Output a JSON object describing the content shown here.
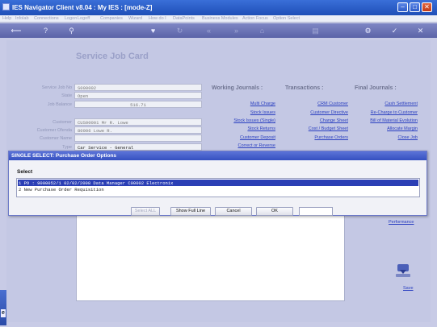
{
  "window": {
    "title": "IES Navigator Client v8.04 : My IES :      [mode-Z]"
  },
  "menu": [
    {
      "label": "Help",
      "active": true
    },
    {
      "label": "Infolab",
      "active": true
    },
    {
      "label": "Connections",
      "active": false
    },
    {
      "label": "Logon",
      "active": false
    },
    {
      "label": "Logoff",
      "active": true
    },
    {
      "label": "Companies",
      "active": false
    },
    {
      "label": "Wizard",
      "active": false
    },
    {
      "label": "How do I",
      "active": false
    },
    {
      "label": "DataPoints",
      "active": false
    },
    {
      "label": "Business Modules",
      "active": false
    },
    {
      "label": "Action Focus",
      "active": false
    },
    {
      "label": "Option Select",
      "active": false
    }
  ],
  "page": {
    "heading": "Service Job Card"
  },
  "form": {
    "service_job_label": "Service Job No",
    "service_job_value": "S000002",
    "state_label": "State",
    "state_value": "Open",
    "job_balance_label": "Job Balance",
    "job_balance_value": "516.71",
    "customer_label": "Customer",
    "customer_value": "CUS00001 Mr R. Lowe",
    "customer_ofenda_label": "Customer Ofenda",
    "customer_ofenda_value": "80006 Lowe R.",
    "customer_name_label": "Customer Name",
    "type_label": "Type",
    "type_value": "Car Service - General"
  },
  "working_journals": {
    "heading": "Working Journals :",
    "links": [
      "Multi Charge",
      "Stock Issues",
      "Stock Issues (Single)",
      "Stock Returns",
      "Customer Deposit",
      "Correct or Reverse"
    ]
  },
  "transactions": {
    "heading": "Transactions :",
    "links": [
      "CRM Customer",
      "Customer Directive",
      "Change Sheet",
      "Cost / Budget Sheet",
      "Purchase Orders"
    ]
  },
  "final_journals": {
    "heading": "Final Journals :",
    "links": [
      "Cash Settlement",
      "Re-Charge to Customer",
      "Bill of Material Evolution",
      "Allocate Margin",
      "Close Job"
    ]
  },
  "sidebar": {
    "performance": "Performance",
    "save": "Save"
  },
  "dialog": {
    "title": "SINGLE SELECT: Purchase Order Options",
    "select_label": "Select",
    "rows": [
      {
        "text": "1   PO : 9000052/1          02/02/2008 Data Manager    C00002 Electronix",
        "selected": true
      },
      {
        "text": "2   New Purchase Order Requisition",
        "selected": false
      }
    ],
    "buttons": {
      "select_all": "Select ALL",
      "show_full_line": "Show Full Line",
      "cancel": "Cancel",
      "ok": "OK"
    }
  },
  "colors": {
    "accent": "#3550c0",
    "selection": "#2b3fb5",
    "link": "#2a3fc0"
  }
}
